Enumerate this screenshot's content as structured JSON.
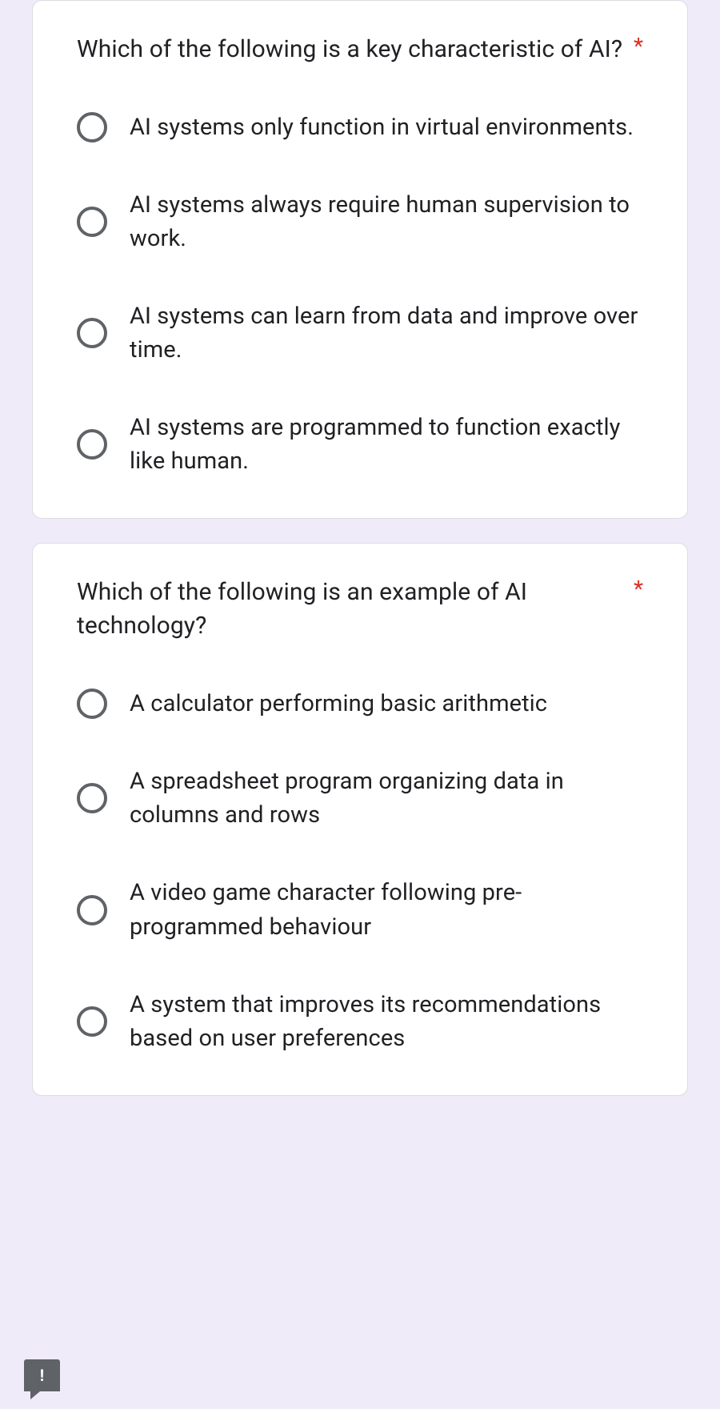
{
  "questions": [
    {
      "text": "Which of the following is a key characteristic of AI?",
      "required": "*",
      "options": [
        "AI systems only function in virtual environments.",
        "AI systems always require human supervision to work.",
        "AI systems can learn from data and improve over time.",
        "AI systems are programmed to function exactly like human."
      ]
    },
    {
      "text": "Which of the following is an example of AI technology?",
      "required": "*",
      "options": [
        "A calculator performing basic arithmetic",
        "A spreadsheet program organizing data in columns and rows",
        "A video game character following pre-programmed behaviour",
        "A system that improves its recommendations based on user preferences"
      ]
    }
  ],
  "feedback_icon": "!"
}
